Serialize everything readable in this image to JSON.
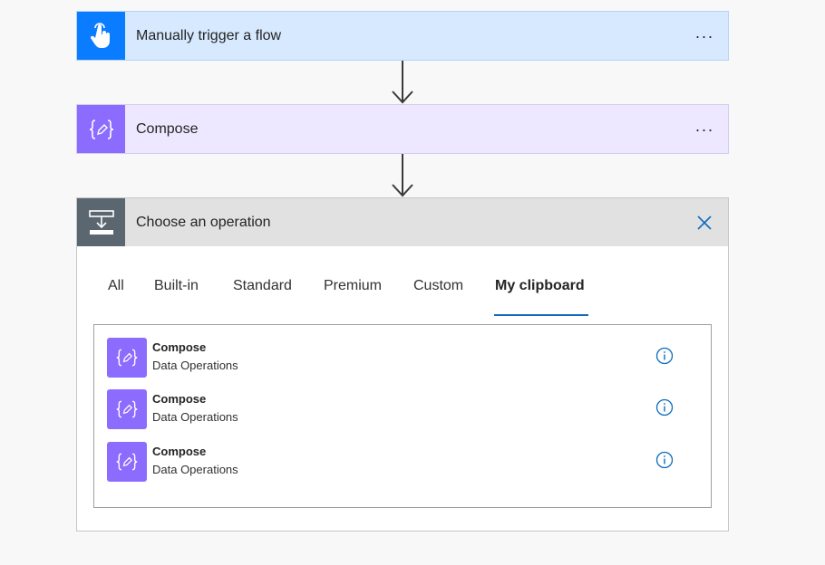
{
  "trigger_card": {
    "title": "Manually trigger a flow",
    "icon": "hand-pointer-icon",
    "header_color": "#d6e9ff",
    "icon_bg": "#0a7cff",
    "more_label": "···"
  },
  "compose_card": {
    "title": "Compose",
    "icon": "curly-braces-icon",
    "header_color": "#ede8ff",
    "icon_bg": "#8c6cff",
    "more_label": "···"
  },
  "operation_card": {
    "title": "Choose an operation",
    "icon": "operation-insert-icon",
    "header_color": "#e1e1e1",
    "icon_bg": "#5b6770",
    "close_icon": "close-icon",
    "tabs": [
      {
        "label": "All",
        "active": false
      },
      {
        "label": "Built-in",
        "active": false
      },
      {
        "label": "Standard",
        "active": false
      },
      {
        "label": "Premium",
        "active": false
      },
      {
        "label": "Custom",
        "active": false
      },
      {
        "label": "My clipboard",
        "active": true
      }
    ],
    "items": [
      {
        "title": "Compose",
        "subtitle": "Data Operations",
        "icon": "curly-braces-icon",
        "info_icon": "info-icon"
      },
      {
        "title": "Compose",
        "subtitle": "Data Operations",
        "icon": "curly-braces-icon",
        "info_icon": "info-icon"
      },
      {
        "title": "Compose",
        "subtitle": "Data Operations",
        "icon": "curly-braces-icon",
        "info_icon": "info-icon"
      }
    ]
  },
  "colors": {
    "accent": "#0f6cbd",
    "info_blue": "#0f6cbd",
    "arrow": "#3b3a39"
  }
}
